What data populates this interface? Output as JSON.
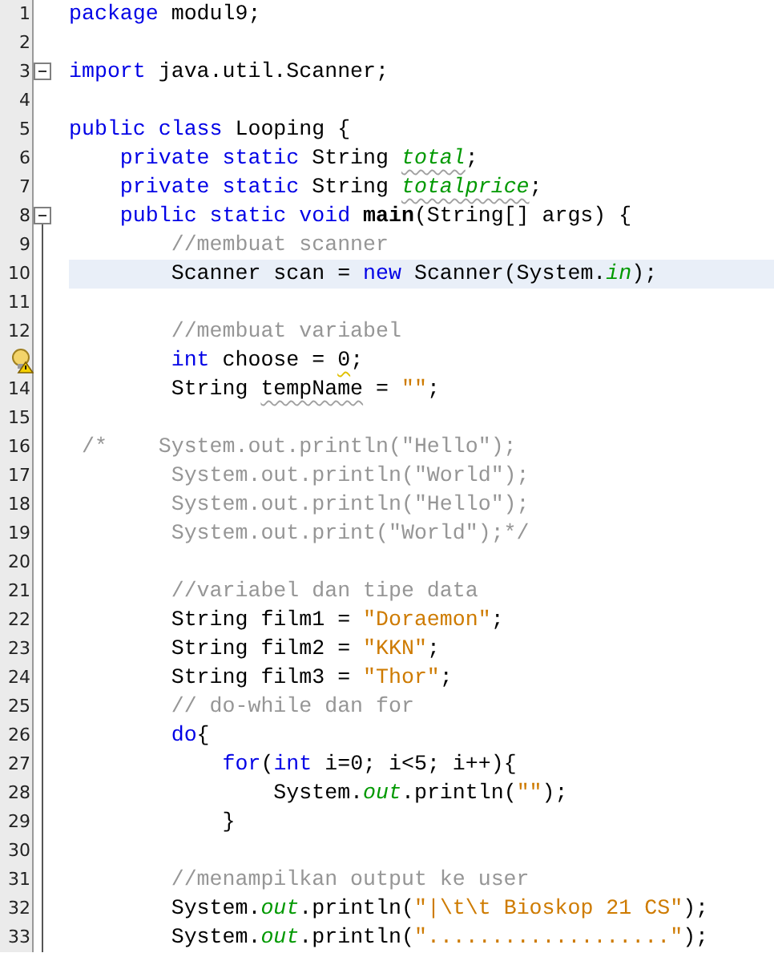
{
  "editor": {
    "lines": [
      {
        "number": "1",
        "selected": false,
        "tokens": [
          {
            "kind": "keyword",
            "t": "package"
          },
          {
            "kind": "plain",
            "t": " modul9;"
          }
        ]
      },
      {
        "number": "2",
        "selected": false
      },
      {
        "number": "3",
        "selected": false,
        "fold_toggle": true,
        "tokens": [
          {
            "kind": "keyword",
            "t": "import"
          },
          {
            "kind": "plain",
            "t": " java.util.Scanner;"
          }
        ]
      },
      {
        "number": "4",
        "selected": false
      },
      {
        "number": "5",
        "selected": false,
        "tokens": [
          {
            "kind": "keyword",
            "t": "public class"
          },
          {
            "kind": "plain",
            "t": " Looping {"
          }
        ]
      },
      {
        "number": "6",
        "selected": false,
        "tokens": [
          {
            "kind": "keyword",
            "t": "    private static"
          },
          {
            "kind": "plain",
            "t": " String "
          },
          {
            "kind": "field",
            "t": "total",
            "unused": true
          },
          {
            "kind": "plain",
            "t": ";"
          }
        ]
      },
      {
        "number": "7",
        "selected": false,
        "tokens": [
          {
            "kind": "keyword",
            "t": "    private static"
          },
          {
            "kind": "plain",
            "t": " String "
          },
          {
            "kind": "field",
            "t": "totalprice",
            "unused": true
          },
          {
            "kind": "plain",
            "t": ";"
          }
        ]
      },
      {
        "number": "8",
        "selected": false,
        "fold_toggle": true,
        "tokens": [
          {
            "kind": "keyword",
            "t": "    public static void "
          },
          {
            "kind": "method",
            "t": "main"
          },
          {
            "kind": "plain",
            "t": "(String[] args) {"
          }
        ]
      },
      {
        "number": "9",
        "selected": false,
        "fold_body": true,
        "tokens": [
          {
            "kind": "comment",
            "t": "        //membuat scanner"
          }
        ]
      },
      {
        "number": "10",
        "selected": true,
        "fold_body": true,
        "tokens": [
          {
            "kind": "plain",
            "t": "        Scanner scan = "
          },
          {
            "kind": "keyword",
            "t": "new"
          },
          {
            "kind": "plain",
            "t": " Scanner(System."
          },
          {
            "kind": "field",
            "t": "in"
          },
          {
            "kind": "plain",
            "t": ");"
          }
        ]
      },
      {
        "number": "11",
        "selected": false,
        "fold_body": true
      },
      {
        "number": "12",
        "selected": false,
        "fold_body": true,
        "tokens": [
          {
            "kind": "comment",
            "t": "        //membuat variabel"
          }
        ]
      },
      {
        "hint_icon": true,
        "selected": false,
        "fold_body": true,
        "tokens": [
          {
            "kind": "keyword",
            "t": "        int"
          },
          {
            "kind": "plain",
            "t": " choose = "
          },
          {
            "kind": "plain",
            "t": "0",
            "warning": true
          },
          {
            "kind": "plain",
            "t": ";"
          }
        ]
      },
      {
        "number": "14",
        "selected": false,
        "fold_body": true,
        "tokens": [
          {
            "kind": "plain",
            "t": "        String "
          },
          {
            "kind": "plain",
            "t": "tempName",
            "unused": true
          },
          {
            "kind": "plain",
            "t": " = "
          },
          {
            "kind": "string",
            "t": "\"\""
          },
          {
            "kind": "plain",
            "t": ";"
          }
        ]
      },
      {
        "number": "15",
        "selected": false,
        "fold_body": true
      },
      {
        "number": "16",
        "selected": false,
        "fold_body": true,
        "tokens": [
          {
            "kind": "comment",
            "t": " /*    System.out.println(\"Hello\");"
          }
        ]
      },
      {
        "number": "17",
        "selected": false,
        "fold_body": true,
        "tokens": [
          {
            "kind": "comment",
            "t": "        System.out.println(\"World\");"
          }
        ]
      },
      {
        "number": "18",
        "selected": false,
        "fold_body": true,
        "tokens": [
          {
            "kind": "comment",
            "t": "        System.out.println(\"Hello\");"
          }
        ]
      },
      {
        "number": "19",
        "selected": false,
        "fold_body": true,
        "tokens": [
          {
            "kind": "comment",
            "t": "        System.out.print(\"World\");*/"
          }
        ]
      },
      {
        "number": "20",
        "selected": false,
        "fold_body": true
      },
      {
        "number": "21",
        "selected": false,
        "fold_body": true,
        "tokens": [
          {
            "kind": "comment",
            "t": "        //variabel dan tipe data"
          }
        ]
      },
      {
        "number": "22",
        "selected": false,
        "fold_body": true,
        "tokens": [
          {
            "kind": "plain",
            "t": "        String film1 = "
          },
          {
            "kind": "string",
            "t": "\"Doraemon\""
          },
          {
            "kind": "plain",
            "t": ";"
          }
        ]
      },
      {
        "number": "23",
        "selected": false,
        "fold_body": true,
        "tokens": [
          {
            "kind": "plain",
            "t": "        String film2 = "
          },
          {
            "kind": "string",
            "t": "\"KKN\""
          },
          {
            "kind": "plain",
            "t": ";"
          }
        ]
      },
      {
        "number": "24",
        "selected": false,
        "fold_body": true,
        "tokens": [
          {
            "kind": "plain",
            "t": "        String film3 = "
          },
          {
            "kind": "string",
            "t": "\"Thor\""
          },
          {
            "kind": "plain",
            "t": ";"
          }
        ]
      },
      {
        "number": "25",
        "selected": false,
        "fold_body": true,
        "tokens": [
          {
            "kind": "comment",
            "t": "        // do-while dan for"
          }
        ]
      },
      {
        "number": "26",
        "selected": false,
        "fold_body": true,
        "tokens": [
          {
            "kind": "keyword",
            "t": "        do"
          },
          {
            "kind": "plain",
            "t": "{"
          }
        ]
      },
      {
        "number": "27",
        "selected": false,
        "fold_body": true,
        "tokens": [
          {
            "kind": "keyword",
            "t": "            for"
          },
          {
            "kind": "plain",
            "t": "("
          },
          {
            "kind": "keyword",
            "t": "int"
          },
          {
            "kind": "plain",
            "t": " i=0; i<5; i++){"
          }
        ]
      },
      {
        "number": "28",
        "selected": false,
        "fold_body": true,
        "tokens": [
          {
            "kind": "plain",
            "t": "                System."
          },
          {
            "kind": "field",
            "t": "out"
          },
          {
            "kind": "plain",
            "t": ".println("
          },
          {
            "kind": "string",
            "t": "\"\""
          },
          {
            "kind": "plain",
            "t": ");"
          }
        ]
      },
      {
        "number": "29",
        "selected": false,
        "fold_body": true,
        "tokens": [
          {
            "kind": "plain",
            "t": "            }"
          }
        ]
      },
      {
        "number": "30",
        "selected": false,
        "fold_body": true
      },
      {
        "number": "31",
        "selected": false,
        "fold_body": true,
        "tokens": [
          {
            "kind": "comment",
            "t": "        //menampilkan output ke user"
          }
        ]
      },
      {
        "number": "32",
        "selected": false,
        "fold_body": true,
        "tokens": [
          {
            "kind": "plain",
            "t": "        System."
          },
          {
            "kind": "field",
            "t": "out"
          },
          {
            "kind": "plain",
            "t": ".println("
          },
          {
            "kind": "string",
            "t": "\"|\\t\\t Bioskop 21 CS\""
          },
          {
            "kind": "plain",
            "t": ");"
          }
        ]
      },
      {
        "number": "33",
        "selected": false,
        "fold_body": true,
        "tokens": [
          {
            "kind": "plain",
            "t": "        System."
          },
          {
            "kind": "field",
            "t": "out"
          },
          {
            "kind": "plain",
            "t": ".println("
          },
          {
            "kind": "string",
            "t": "\"...................\""
          },
          {
            "kind": "plain",
            "t": ");"
          }
        ]
      }
    ]
  }
}
